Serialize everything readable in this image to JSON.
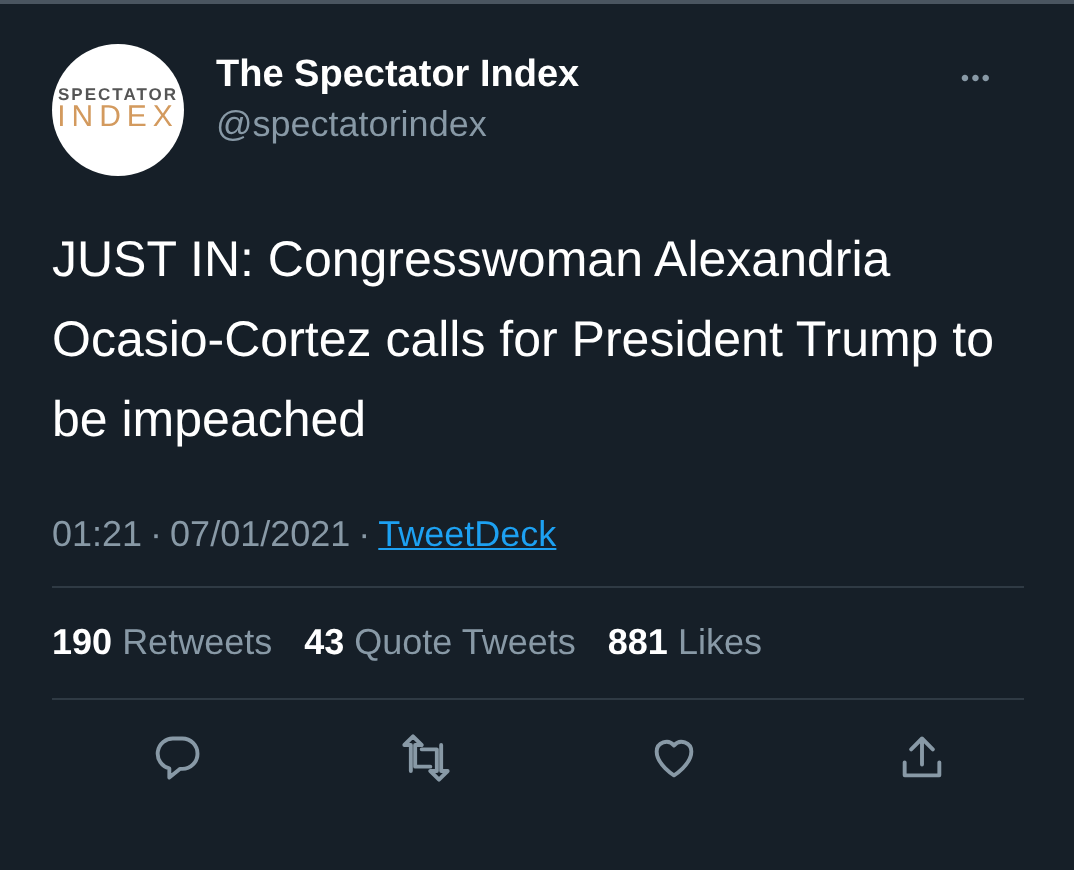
{
  "author": {
    "avatar_lines": [
      "SPECTATOR",
      "INDEX"
    ],
    "name": "The Spectator Index",
    "handle": "@spectatorindex",
    "more": "•••"
  },
  "tweet": {
    "text": "JUST IN: Congresswoman Alexandria Ocasio-Cortez calls for President Trump to be impeached"
  },
  "meta": {
    "time": "01:21",
    "separator_1": "·",
    "date": "07/01/2021",
    "separator_2": "·",
    "source": "TweetDeck"
  },
  "stats": [
    {
      "count": "190",
      "label": "Retweets"
    },
    {
      "count": "43",
      "label": "Quote Tweets"
    },
    {
      "count": "881",
      "label": "Likes"
    }
  ],
  "actions": [
    {
      "kind": "reply"
    },
    {
      "kind": "retweet"
    },
    {
      "kind": "like"
    },
    {
      "kind": "share"
    }
  ]
}
